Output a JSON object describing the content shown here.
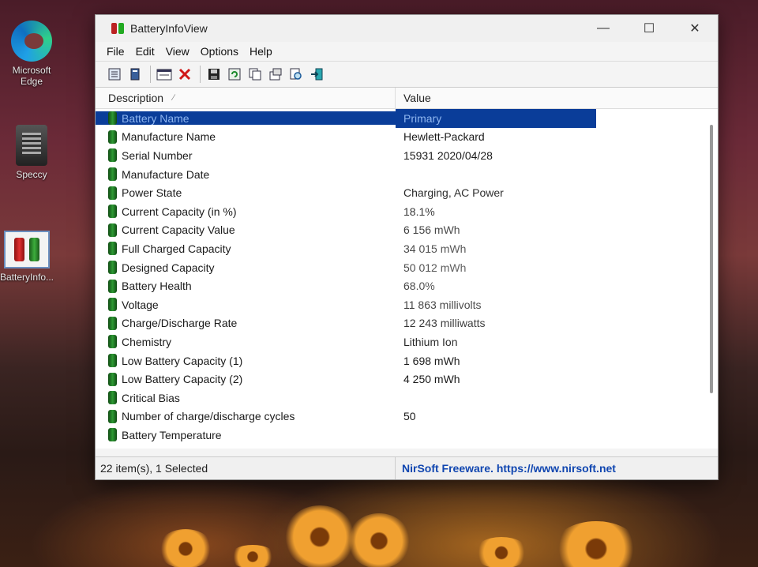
{
  "desktop": {
    "icons": [
      {
        "label": "Microsoft Edge"
      },
      {
        "label": "Speccy"
      },
      {
        "label": "BatteryInfo..."
      }
    ]
  },
  "window": {
    "title": "BatteryInfoView",
    "controls": {
      "minimize": "—",
      "maximize": "☐",
      "close": "✕"
    }
  },
  "menu": {
    "items": [
      "File",
      "Edit",
      "View",
      "Options",
      "Help"
    ]
  },
  "list": {
    "columns": {
      "description": "Description",
      "value": "Value"
    },
    "rows": [
      {
        "description": "Battery Name",
        "value": "Primary",
        "selected": true
      },
      {
        "description": "Manufacture Name",
        "value": "Hewlett-Packard"
      },
      {
        "description": "Serial Number",
        "value": "15931 2020/04/28"
      },
      {
        "description": "Manufacture Date",
        "value": ""
      },
      {
        "description": "Power State",
        "value": "Charging, AC Power"
      },
      {
        "description": "Current Capacity (in %)",
        "value": "18.1%"
      },
      {
        "description": "Current Capacity Value",
        "value": "6 156 mWh"
      },
      {
        "description": "Full Charged Capacity",
        "value": "34 015 mWh"
      },
      {
        "description": "Designed Capacity",
        "value": "50 012 mWh"
      },
      {
        "description": "Battery Health",
        "value": "68.0%"
      },
      {
        "description": "Voltage",
        "value": "11 863 millivolts"
      },
      {
        "description": "Charge/Discharge Rate",
        "value": "12 243 milliwatts"
      },
      {
        "description": "Chemistry",
        "value": "Lithium Ion"
      },
      {
        "description": "Low Battery Capacity (1)",
        "value": "1 698 mWh"
      },
      {
        "description": "Low Battery Capacity (2)",
        "value": "4 250 mWh"
      },
      {
        "description": "Critical Bias",
        "value": ""
      },
      {
        "description": "Number of charge/discharge cycles",
        "value": "50"
      },
      {
        "description": "Battery Temperature",
        "value": ""
      }
    ]
  },
  "status": {
    "items_text": "22 item(s), 1 Selected",
    "link_text": "NirSoft Freeware. https://www.nirsoft.net"
  },
  "colors": {
    "selection": "#0a3d99",
    "link": "#1046b0",
    "battery_icon": "#2e9a34"
  }
}
